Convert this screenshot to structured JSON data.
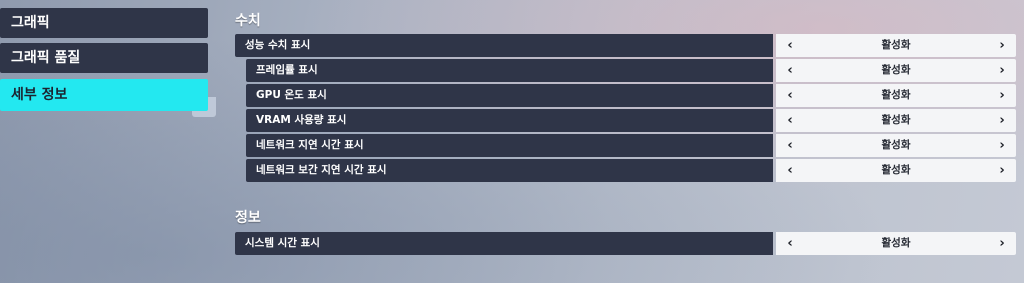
{
  "sidebar": {
    "items": [
      {
        "label": "그래픽"
      },
      {
        "label": "그래픽 품질"
      },
      {
        "label": "세부 정보"
      }
    ]
  },
  "sections": [
    {
      "title": "수치",
      "rows": [
        {
          "label": "성능 수치 표시",
          "value": "활성화"
        },
        {
          "label": "프레임률 표시",
          "value": "활성화"
        },
        {
          "label": "GPU 온도 표시",
          "value": "활성화"
        },
        {
          "label": "VRAM 사용량 표시",
          "value": "활성화"
        },
        {
          "label": "네트워크 지연 시간 표시",
          "value": "활성화"
        },
        {
          "label": "네트워크 보간 지연 시간 표시",
          "value": "활성화"
        }
      ]
    },
    {
      "title": "정보",
      "rows": [
        {
          "label": "시스템 시간 표시",
          "value": "활성화"
        }
      ]
    }
  ],
  "arrows": {
    "left": "‹",
    "right": "›"
  }
}
